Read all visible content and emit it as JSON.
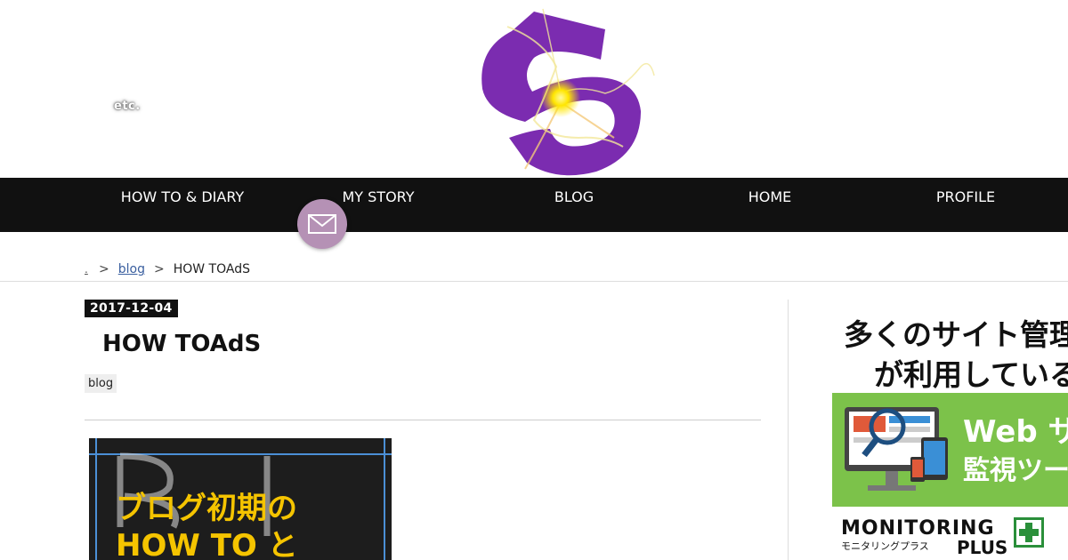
{
  "header": {
    "etc_label": "etc."
  },
  "nav": {
    "items": [
      "HOW TO & DIARY",
      "MY STORY",
      "BLOG",
      "HOME",
      "PROFILE"
    ]
  },
  "breadcrumb": {
    "home": ".",
    "sep": ">",
    "category": "blog",
    "current": "HOW TOAdS"
  },
  "post": {
    "date": "2017-12-04",
    "title": "HOW TOAdS",
    "category": "blog",
    "image_text_line1": "ブログ初期の",
    "image_text_line2": "HOW TO と"
  },
  "ad": {
    "line1": "多くのサイト管理",
    "line2": "が利用している",
    "banner_line1": "Web サ",
    "banner_line2": "監視ツー",
    "brand": "MONITORING",
    "brand_plus": "PLUS",
    "brand_sub": "モニタリングプラス"
  },
  "colors": {
    "nav_bg": "#111111",
    "logo_purple": "#7b2cb0",
    "mail_button": "#b591b5",
    "ad_green": "#7cc24a",
    "link": "#3a5f9f"
  },
  "icons": {
    "mail": "envelope-icon",
    "logo": "site-logo-icon"
  }
}
